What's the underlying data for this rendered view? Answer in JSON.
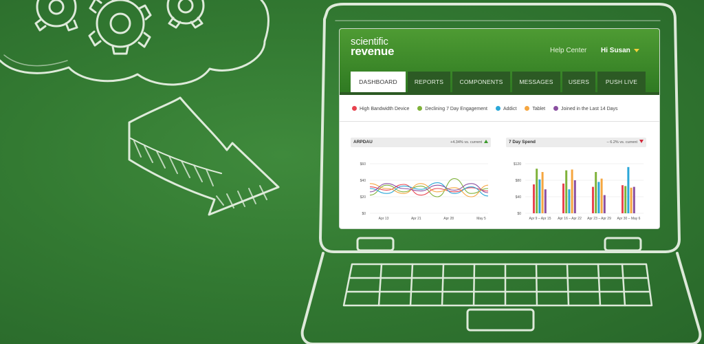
{
  "app": {
    "logo_line1": "scientific",
    "logo_line2": "revenue",
    "help_label": "Help Center",
    "user_label": "Hi Susan"
  },
  "tabs": [
    {
      "label": "DASHBOARD",
      "active": true
    },
    {
      "label": "REPORTS",
      "active": false
    },
    {
      "label": "COMPONENTS",
      "active": false
    },
    {
      "label": "MESSAGES",
      "active": false
    },
    {
      "label": "USERS",
      "active": false
    },
    {
      "label": "PUSH LIVE",
      "active": false
    }
  ],
  "segments": [
    {
      "label": "High Bandwidth Device",
      "color": "#e8434f"
    },
    {
      "label": "Declining 7 Day Engagement",
      "color": "#7fb23a"
    },
    {
      "label": "Addict",
      "color": "#2aa7d8"
    },
    {
      "label": "Tablet",
      "color": "#f5a640"
    },
    {
      "label": "Joined in the Last 14 Days",
      "color": "#8a4fa0"
    }
  ],
  "panels": {
    "arpdau": {
      "title": "ARPDAU",
      "delta": "+4.34% vs. current",
      "trend": "up"
    },
    "spend": {
      "title": "7 Day Spend",
      "delta": "– 6.2% vs. current",
      "trend": "down"
    }
  },
  "chart_data": [
    {
      "type": "line",
      "title": "ARPDAU",
      "y_ticks": [
        "$60",
        "$40",
        "$20",
        "$0"
      ],
      "x_ticks": [
        "Apr 13",
        "Apr 21",
        "Apr 28",
        "May 5"
      ],
      "ylim": [
        0,
        60
      ],
      "x_count": 8,
      "series": [
        {
          "color": "#e8434f",
          "values": [
            32,
            28,
            35,
            22,
            30,
            26,
            31,
            27
          ]
        },
        {
          "color": "#7fb23a",
          "values": [
            22,
            34,
            26,
            33,
            20,
            42,
            24,
            30
          ]
        },
        {
          "color": "#2aa7d8",
          "values": [
            30,
            24,
            33,
            29,
            37,
            24,
            32,
            21
          ]
        },
        {
          "color": "#f5a640",
          "values": [
            36,
            30,
            24,
            36,
            26,
            31,
            20,
            34
          ]
        },
        {
          "color": "#8a4fa0",
          "values": [
            26,
            36,
            30,
            27,
            34,
            28,
            36,
            25
          ]
        }
      ]
    },
    {
      "type": "bar",
      "title": "7 Day Spend",
      "y_ticks": [
        "$120",
        "$80",
        "$40",
        "$0"
      ],
      "ylim": [
        0,
        120
      ],
      "categories": [
        "Apr 9 – Apr 15",
        "Apr 16 – Apr 22",
        "Apr 23 – Apr 29",
        "Apr 30 – May 6"
      ],
      "series": [
        {
          "color": "#e8434f",
          "values": [
            70,
            72,
            64,
            68
          ]
        },
        {
          "color": "#7fb23a",
          "values": [
            108,
            104,
            100,
            66
          ]
        },
        {
          "color": "#2aa7d8",
          "values": [
            82,
            58,
            76,
            112
          ]
        },
        {
          "color": "#f5a640",
          "values": [
            100,
            106,
            84,
            62
          ]
        },
        {
          "color": "#8a4fa0",
          "values": [
            58,
            80,
            44,
            64
          ]
        }
      ]
    }
  ]
}
